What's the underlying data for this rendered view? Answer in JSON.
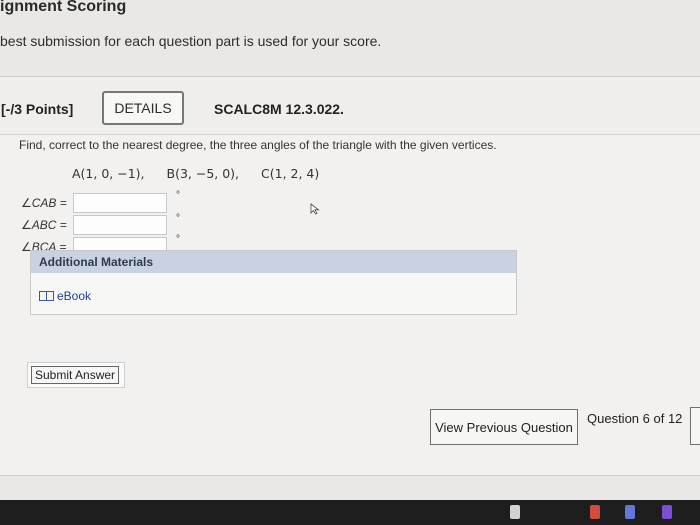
{
  "header": {
    "title": "ignment Scoring",
    "note": "best submission for each question part is used for your score."
  },
  "question_card": {
    "points": "[-/3 Points]",
    "details_label": "DETAILS",
    "code": "SCALC8M 12.3.022.",
    "prompt": "Find, correct to the nearest degree, the three angles of the triangle with the given vertices.",
    "vertices": [
      "A(1, 0, −1),",
      "B(3, −5, 0),",
      "C(1, 2, 4)"
    ],
    "angles": [
      {
        "label": "∠CAB =",
        "value": ""
      },
      {
        "label": "∠ABC =",
        "value": ""
      },
      {
        "label": "∠BCA =",
        "value": ""
      }
    ],
    "degree_symbol": "°",
    "materials_title": "Additional Materials",
    "ebook_label": "eBook",
    "submit_label": "Submit Answer"
  },
  "navigation": {
    "previous_label": "View Previous Question",
    "position_text": "Question 6 of 12"
  },
  "icons": {
    "book": "book-icon",
    "cursor": "mouse-cursor-icon"
  },
  "colors": {
    "background": "#e9e8e6",
    "materials_header": "#c9d2e3",
    "ebook_link": "#1f3f9a"
  }
}
